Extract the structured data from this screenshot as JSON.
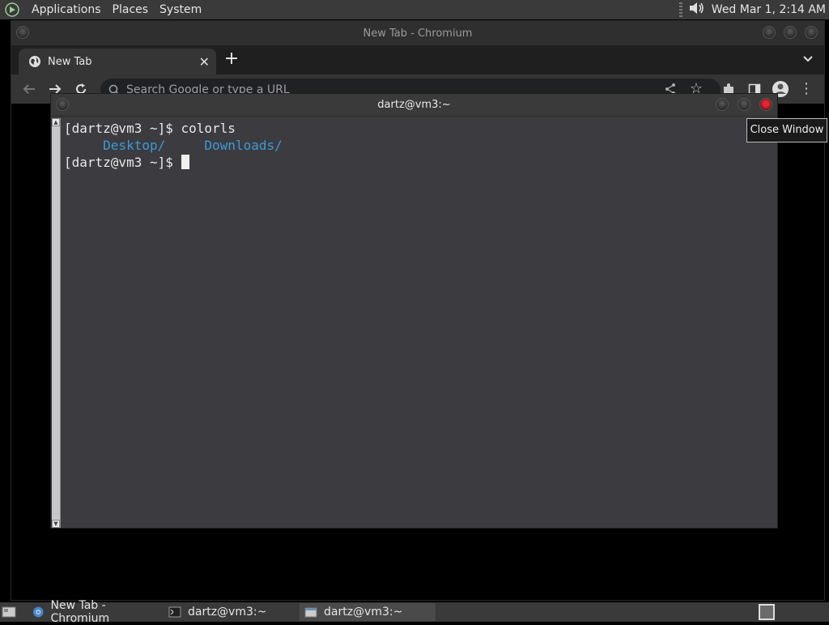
{
  "top_panel": {
    "menus": [
      "Applications",
      "Places",
      "System"
    ],
    "clock": "Wed Mar  1,  2:14 AM"
  },
  "chromium": {
    "title": "New Tab - Chromium",
    "tab_label": "New Tab",
    "omnibox_placeholder": "Search Google or type a URL"
  },
  "terminal": {
    "title": "dartz@vm3:~",
    "lines": [
      {
        "prompt": "[dartz@vm3 ~]$ ",
        "command": "colorls"
      },
      {
        "indent": "    ",
        "dir1_icon": "",
        "dir1": "Desktop/",
        "gap": "    ",
        "dir2_icon": "",
        "dir2": "Downloads/"
      },
      {
        "prompt": "[dartz@vm3 ~]$ ",
        "command": ""
      }
    ],
    "accent_color": "#3a9bd8"
  },
  "tooltip": {
    "text": "Close Window"
  },
  "taskbar": {
    "tasks": [
      {
        "label": "New Tab - Chromium",
        "icon": "chromium-icon"
      },
      {
        "label": "dartz@vm3:~",
        "icon": "terminal-icon"
      },
      {
        "label": "dartz@vm3:~",
        "icon": "window-icon",
        "active": true
      }
    ]
  }
}
